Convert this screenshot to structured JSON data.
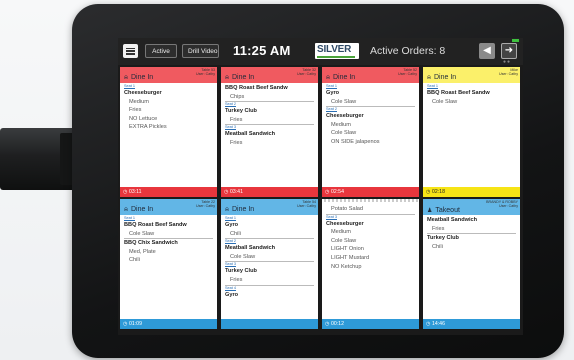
{
  "topbar": {
    "active_label": "Active",
    "drill_label": "Drill Video",
    "clock": "11:25 AM",
    "logo_text": "SILVER",
    "orders_text": "Active Orders: 8",
    "back_icon": "arrow-left-icon",
    "next_icon": "arrow-right-icon"
  },
  "colors": {
    "red": "#e8363d",
    "yellow": "#f6e416",
    "blue": "#2e9ad8",
    "header_red": "#f05a60",
    "header_yellow": "#fbf06a",
    "header_blue": "#62b6e6"
  },
  "tickets": [
    {
      "type": "Dine In",
      "meta1": "Table 53",
      "meta2": "User: Cathy",
      "color": "red",
      "timer": "03:11",
      "lines": [
        {
          "t": "seat",
          "v": "Seat 1"
        },
        {
          "t": "bold",
          "v": "Cheeseburger"
        },
        {
          "t": "mod",
          "v": "Medium"
        },
        {
          "t": "mod",
          "v": "Fries"
        },
        {
          "t": "mod",
          "v": "NO Lettuce"
        },
        {
          "t": "mod",
          "v": "EXTRA Pickles"
        }
      ]
    },
    {
      "type": "Dine In",
      "meta1": "Table 32",
      "meta2": "User: Cathy",
      "color": "red",
      "timer": "03:41",
      "lines": [
        {
          "t": "bold",
          "v": "BBQ Roast Beef Sandw"
        },
        {
          "t": "modsep",
          "v": "Chips"
        },
        {
          "t": "seat",
          "v": "Seat 2"
        },
        {
          "t": "bold",
          "v": "Turkey Club"
        },
        {
          "t": "modsep",
          "v": "Fries"
        },
        {
          "t": "seat",
          "v": "Seat 3"
        },
        {
          "t": "bold",
          "v": "Meatball Sandwich"
        },
        {
          "t": "mod",
          "v": "Fries"
        }
      ]
    },
    {
      "type": "Dine In",
      "meta1": "Table 52",
      "meta2": "User: Cathy",
      "color": "red",
      "timer": "02:54",
      "lines": [
        {
          "t": "seat",
          "v": "Seat 1"
        },
        {
          "t": "bold",
          "v": "Gyro"
        },
        {
          "t": "modsep",
          "v": "Cole Slaw"
        },
        {
          "t": "seat",
          "v": "Seat 2"
        },
        {
          "t": "bold",
          "v": "Cheeseburger"
        },
        {
          "t": "mod",
          "v": "Medium"
        },
        {
          "t": "mod",
          "v": "Cole Slaw"
        },
        {
          "t": "mod",
          "v": "ON SIDE jalapenos"
        }
      ]
    },
    {
      "type": "Dine In",
      "meta1": "Mike",
      "meta2": "User: Cathy",
      "color": "yellow",
      "timer": "02:18",
      "lines": [
        {
          "t": "seat",
          "v": "Seat 1"
        },
        {
          "t": "bold",
          "v": "BBQ Roast Beef Sandw"
        },
        {
          "t": "mod",
          "v": "Cole Slaw"
        }
      ]
    },
    {
      "type": "Dine In",
      "meta1": "Table 22",
      "meta2": "User: Cathy",
      "color": "blue",
      "timer": "01:09",
      "lines": [
        {
          "t": "seat",
          "v": "Seat 1"
        },
        {
          "t": "bold",
          "v": "BBQ Roast Beef Sandw"
        },
        {
          "t": "modsep",
          "v": "Cole Slaw"
        },
        {
          "t": "bold",
          "v": "BBQ Chix Sandwich"
        },
        {
          "t": "mod",
          "v": "Med, Plate"
        },
        {
          "t": "mod",
          "v": "Chili"
        }
      ]
    },
    {
      "type": "Dine In",
      "meta1": "Table 54",
      "meta2": "User: Cathy",
      "color": "blue",
      "timer": "",
      "lines": [
        {
          "t": "seat",
          "v": "Seat 1"
        },
        {
          "t": "bold",
          "v": "Gyro"
        },
        {
          "t": "modsep",
          "v": "Chili"
        },
        {
          "t": "seat",
          "v": "Seat 2"
        },
        {
          "t": "bold",
          "v": "Meatball Sandwich"
        },
        {
          "t": "modsep",
          "v": "Cole Slaw"
        },
        {
          "t": "seat",
          "v": "Seat 3"
        },
        {
          "t": "bold",
          "v": "Turkey Club"
        },
        {
          "t": "modsep",
          "v": "Fries"
        },
        {
          "t": "seat",
          "v": "Seat 4"
        },
        {
          "t": "bold",
          "v": "Gyro"
        }
      ]
    },
    {
      "type": "",
      "meta1": "",
      "meta2": "",
      "color": "continued",
      "timer": "00:12",
      "lines": [
        {
          "t": "modsep",
          "v": "Potato Salad"
        },
        {
          "t": "seat",
          "v": "Seat 3"
        },
        {
          "t": "bold",
          "v": "Cheeseburger"
        },
        {
          "t": "mod",
          "v": "Medium"
        },
        {
          "t": "mod",
          "v": "Cole Slaw"
        },
        {
          "t": "mod",
          "v": "LIGHT Onion"
        },
        {
          "t": "mod",
          "v": "LIGHT Mustard"
        },
        {
          "t": "mod",
          "v": "NO Ketchup"
        }
      ]
    },
    {
      "type": "Takeout",
      "meta1": "BRANDY & ROBBY",
      "meta2": "User: Cathy",
      "color": "blue",
      "timer": "14:46",
      "lines": [
        {
          "t": "bold",
          "v": "Meatball Sandwich"
        },
        {
          "t": "modsep",
          "v": "Fries"
        },
        {
          "t": "bold",
          "v": "Turkey Club"
        },
        {
          "t": "mod",
          "v": "Chili"
        }
      ]
    }
  ]
}
